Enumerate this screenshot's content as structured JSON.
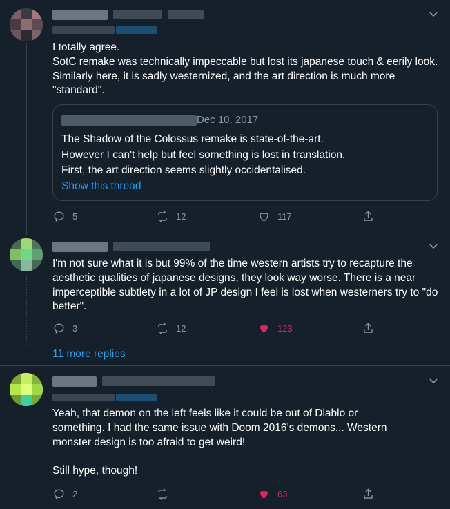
{
  "tweets": [
    {
      "text": "I totally agree.\nSotC remake was technically impeccable but lost its japanese touch & eerily look. Similarly here, it is sadly westernized, and the art direction is much more \"standard\".",
      "quote": {
        "date": "Dec 10, 2017",
        "text": "The Shadow of the Colossus remake is state-of-the-art.\nHowever I can't help but feel something is lost in translation.\nFirst, the art direction seems slightly occidentalised.",
        "show_thread": "Show this thread"
      },
      "replies": "5",
      "retweets": "12",
      "likes": "117"
    },
    {
      "text": "I'm not sure what it is but 99% of the time western artists try to recapture the aesthetic qualities of japanese designs, they look way worse. There is a near imperceptible subtlety in a lot of JP design I feel is lost when westerners try to \"do better\".",
      "replies": "3",
      "retweets": "12",
      "likes": "123",
      "liked": true
    },
    {
      "text": "Yeah, that demon on the left feels like it could be out of Diablo or something. I had the same issue with Doom 2016’s demons... Western monster design is too afraid to get weird!\n\nStill hype, though!",
      "replies": "2",
      "retweets": "",
      "likes": "63",
      "liked": true
    }
  ],
  "more_replies": "11 more replies",
  "colors": {
    "background": "#15202b",
    "border": "#38444d",
    "muted": "#8899a6",
    "link": "#1da1f2",
    "like": "#e0245e"
  }
}
